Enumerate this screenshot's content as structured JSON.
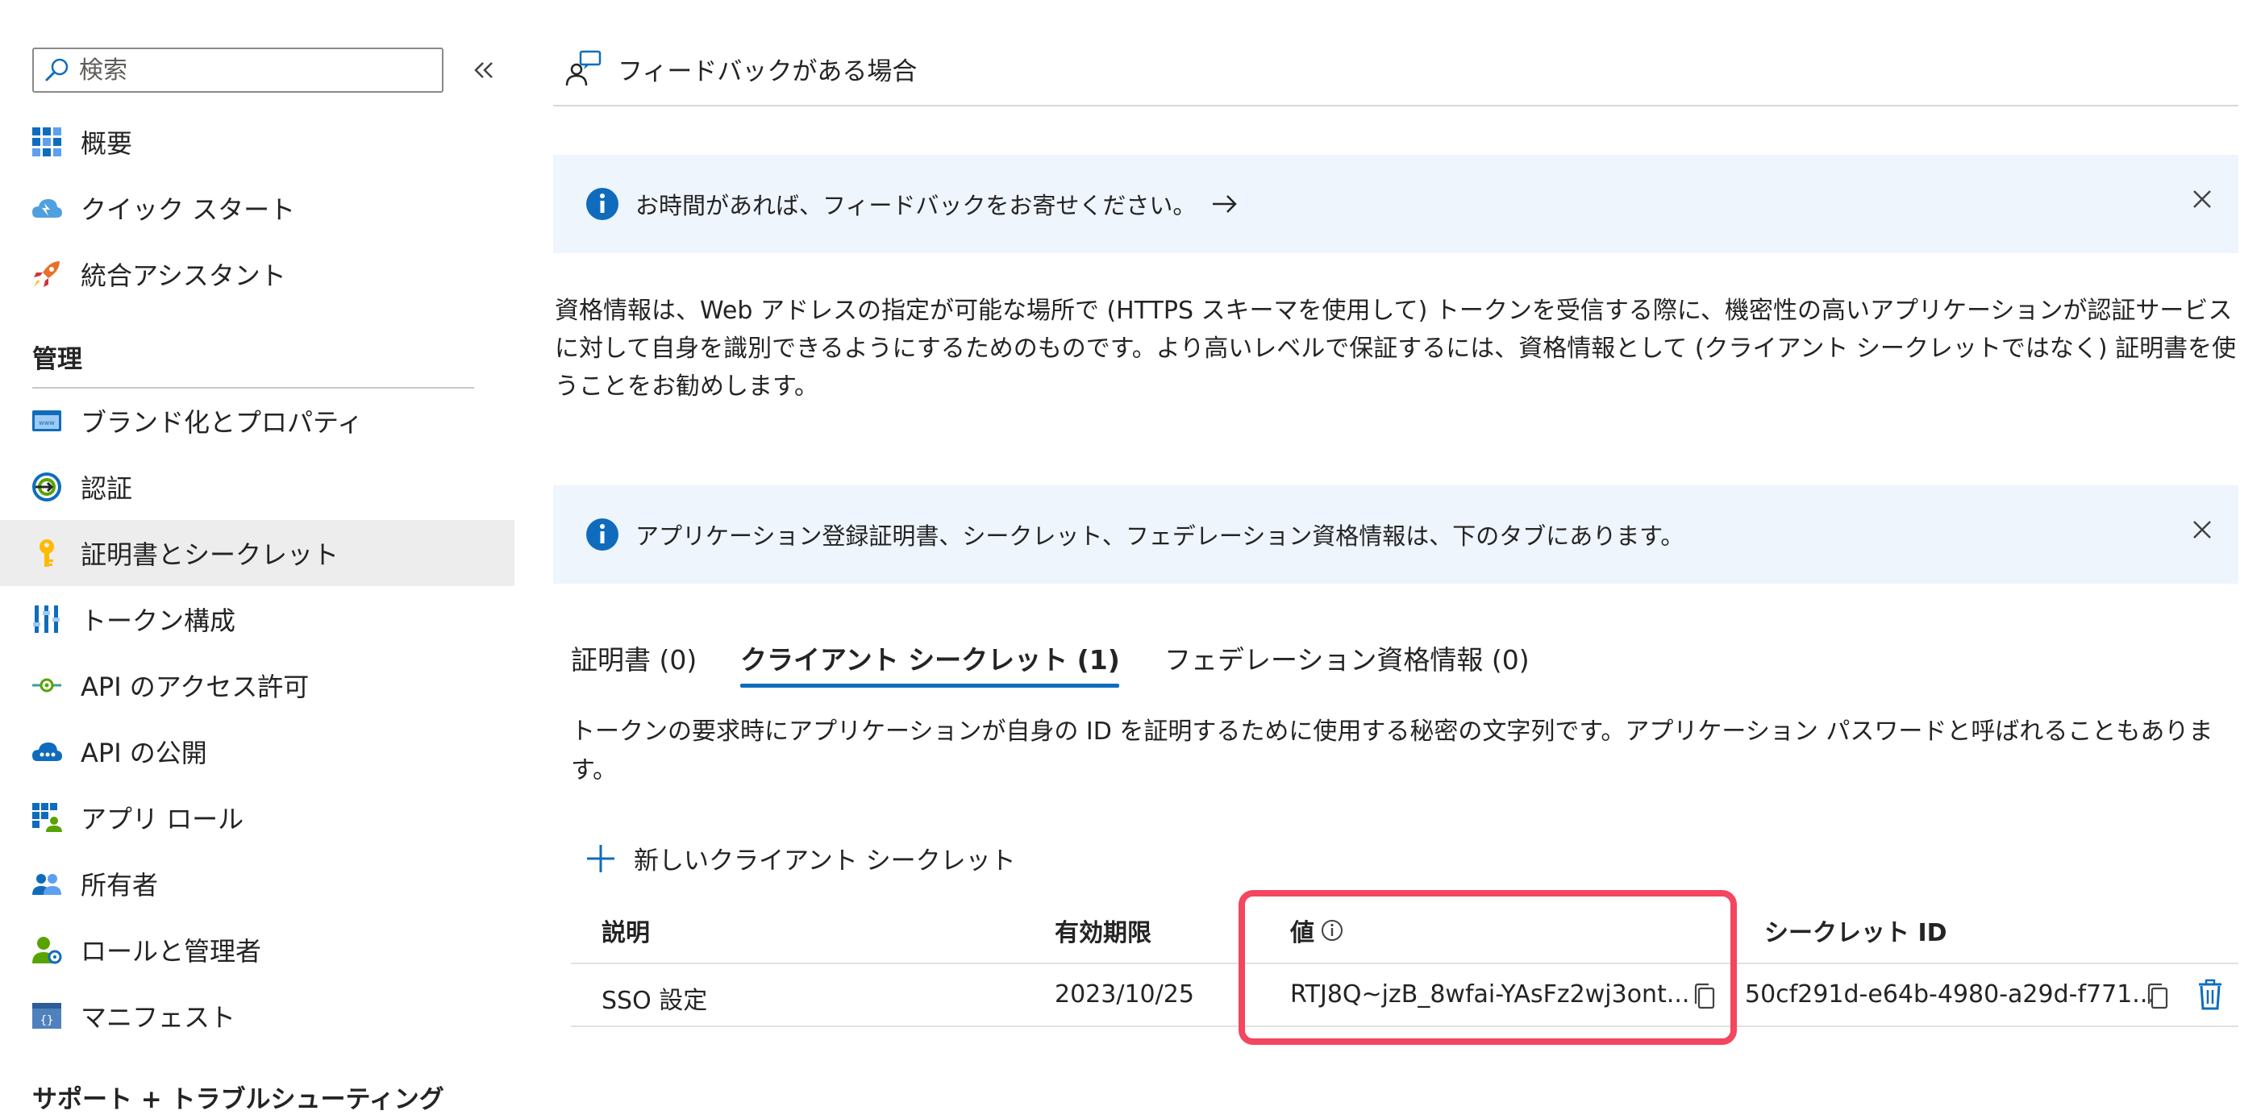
{
  "sidebar": {
    "search_placeholder": "検索",
    "items_top": [
      {
        "label": "概要",
        "icon": "overview-grid-icon"
      },
      {
        "label": "クイック スタート",
        "icon": "quickstart-cloud-icon"
      },
      {
        "label": "統合アシスタント",
        "icon": "rocket-icon"
      }
    ],
    "section_manage": "管理",
    "items_manage": [
      {
        "label": "ブランド化とプロパティ",
        "icon": "branding-icon"
      },
      {
        "label": "認証",
        "icon": "authentication-icon"
      },
      {
        "label": "証明書とシークレット",
        "icon": "key-icon",
        "selected": true
      },
      {
        "label": "トークン構成",
        "icon": "token-config-icon"
      },
      {
        "label": "API のアクセス許可",
        "icon": "api-permissions-icon"
      },
      {
        "label": "API の公開",
        "icon": "expose-api-icon"
      },
      {
        "label": "アプリ ロール",
        "icon": "app-roles-icon"
      },
      {
        "label": "所有者",
        "icon": "owners-icon"
      },
      {
        "label": "ロールと管理者",
        "icon": "roles-admins-icon"
      },
      {
        "label": "マニフェスト",
        "icon": "manifest-icon"
      }
    ],
    "section_support": "サポート + トラブルシューティング"
  },
  "main": {
    "feedback_label": "フィードバックがある場合",
    "info1": "お時間があれば、フィードバックをお寄せください。",
    "description": "資格情報は、Web アドレスの指定が可能な場所で (HTTPS スキーマを使用して) トークンを受信する際に、機密性の高いアプリケーションが認証サービスに対して自身を識別できるようにするためのものです。より高いレベルで保証するには、資格情報として (クライアント シークレットではなく) 証明書を使うことをお勧めします。",
    "info2": "アプリケーション登録証明書、シークレット、フェデレーション資格情報は、下のタブにあります。",
    "tabs": [
      {
        "label": "証明書 (0)"
      },
      {
        "label": "クライアント シークレット (1)",
        "active": true
      },
      {
        "label": "フェデレーション資格情報 (0)"
      }
    ],
    "tab_description": "トークンの要求時にアプリケーションが自身の ID を証明するために使用する秘密の文字列です。アプリケーション パスワードと呼ばれることもあります。",
    "new_secret_label": "新しいクライアント シークレット",
    "table": {
      "headers": [
        "説明",
        "有効期限",
        "値",
        "シークレット ID"
      ],
      "rows": [
        {
          "description": "SSO 設定",
          "expires": "2023/10/25",
          "value": "RTJ8Q~jzB_8wfai-YAsFz2wj3ont...",
          "secret_id": "50cf291d-e64b-4980-a29d-f771..."
        }
      ]
    },
    "colors": {
      "accent": "#0f6cbd",
      "highlight": "#f3465f",
      "info_bg": "#eff5fd",
      "selected_bg": "#ededed"
    }
  }
}
